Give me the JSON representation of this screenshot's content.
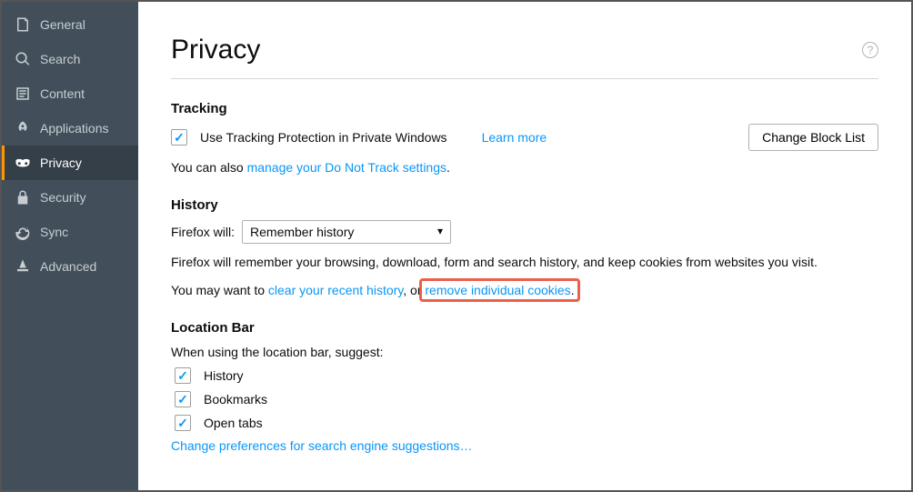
{
  "sidebar": {
    "items": [
      {
        "label": "General"
      },
      {
        "label": "Search"
      },
      {
        "label": "Content"
      },
      {
        "label": "Applications"
      },
      {
        "label": "Privacy"
      },
      {
        "label": "Security"
      },
      {
        "label": "Sync"
      },
      {
        "label": "Advanced"
      }
    ]
  },
  "page": {
    "title": "Privacy"
  },
  "tracking": {
    "heading": "Tracking",
    "checkbox_label": "Use Tracking Protection in Private Windows",
    "learn_more": "Learn more",
    "change_block_list": "Change Block List",
    "you_can_also": "You can also ",
    "manage_dnt": "manage your Do Not Track settings",
    "period": "."
  },
  "history": {
    "heading": "History",
    "firefox_will_label": "Firefox will:",
    "select_value": "Remember history",
    "description": "Firefox will remember your browsing, download, form and search history, and keep cookies from websites you visit.",
    "may_want": "You may want to ",
    "clear_recent": "clear your recent history",
    "or": ", or ",
    "remove_cookies": "remove individual cookies",
    "period": "."
  },
  "location_bar": {
    "heading": "Location Bar",
    "when_using": "When using the location bar, suggest:",
    "opts": [
      {
        "label": "History"
      },
      {
        "label": "Bookmarks"
      },
      {
        "label": "Open tabs"
      }
    ],
    "change_prefs": "Change preferences for search engine suggestions…"
  }
}
